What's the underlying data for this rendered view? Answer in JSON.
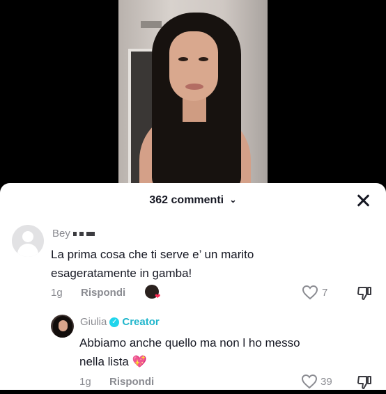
{
  "header": {
    "comment_count": "362 commenti",
    "chevron_icon": "chevron-down-icon",
    "close_icon": "close-icon"
  },
  "comments": [
    {
      "username": "Bey",
      "text_line1": "La prima cosa che ti serve e’ un marito",
      "text_line2": "esageratamente in gamba!",
      "time": "1g",
      "reply_label": "Rispondi",
      "likes": "7"
    },
    {
      "username": "Giulia",
      "creator_label": "Creator",
      "text_line1": "Abbiamo anche quello ma non l ho messo",
      "text_line2": "nella lista",
      "emoji": "💖",
      "time": "1g",
      "reply_label": "Rispondi",
      "likes": "39"
    }
  ],
  "colors": {
    "accent": "#20d5ec",
    "heart": "#fe2c55"
  }
}
